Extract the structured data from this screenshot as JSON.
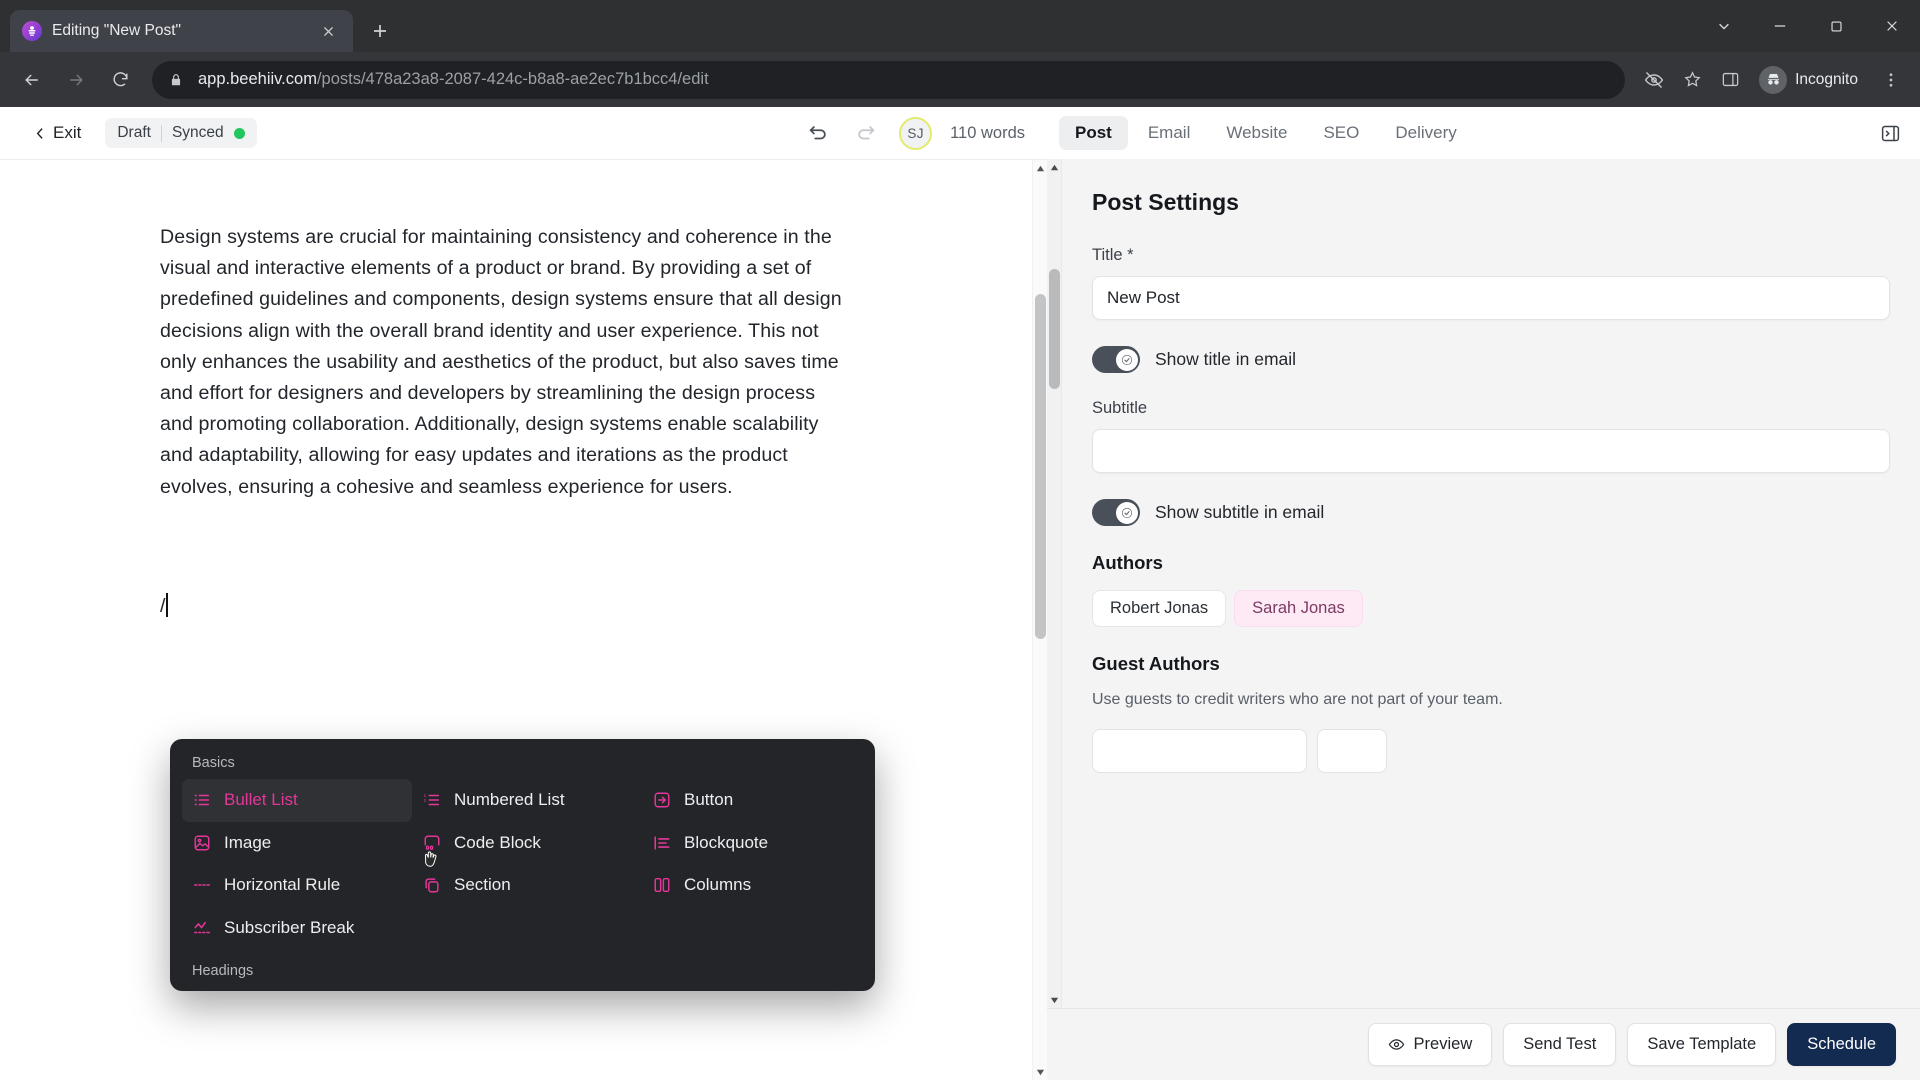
{
  "browser": {
    "tab": {
      "title": "Editing \"New Post\"",
      "favicon": "beehiiv-logo-icon",
      "close": "×"
    },
    "new_tab_label": "+",
    "window_controls": {
      "minimize": "—",
      "maximize": "▢",
      "close": "✕",
      "tab_search": "⌄"
    },
    "url": {
      "secure_icon": "lock-icon",
      "host": "app.beehiiv.com",
      "path": "/posts/478a23a8-2087-424c-b8a8-ae2ec7b1bcc4/edit"
    },
    "profile": {
      "label": "Incognito",
      "icon": "incognito-icon"
    },
    "toolbar_icons": [
      "third-party-cookie-blocked-icon",
      "bookmark-star-icon",
      "side-panel-icon",
      "chrome-menu-icon"
    ]
  },
  "editor": {
    "exit_label": "Exit",
    "status": {
      "state": "Draft",
      "sync": "Synced"
    },
    "word_count": "110 words",
    "avatar_initials": "SJ",
    "undo_label": "Undo",
    "redo_label": "Redo",
    "paragraph": "Design systems are crucial for maintaining consistency and coherence in the visual and interactive elements of a product or brand. By providing a set of predefined guidelines and components, design systems ensure that all design decisions align with the overall brand identity and user experience. This not only enhances the usability and aesthetics of the product, but also saves time and effort for designers and developers by streamlining the design process and promoting collaboration. Additionally, design systems enable scalability and adaptability, allowing for easy updates and iterations as the product evolves, ensuring a cohesive and seamless experience for users.",
    "slash_text": "/"
  },
  "slash_menu": {
    "sections": [
      {
        "label": "Basics",
        "items": [
          {
            "label": "Bullet List",
            "icon": "bullet-list-icon",
            "active": true
          },
          {
            "label": "Numbered List",
            "icon": "numbered-list-icon",
            "active": false
          },
          {
            "label": "Button",
            "icon": "button-icon",
            "active": false
          },
          {
            "label": "Image",
            "icon": "image-icon",
            "active": false
          },
          {
            "label": "Code Block",
            "icon": "code-block-icon",
            "active": false
          },
          {
            "label": "Blockquote",
            "icon": "blockquote-icon",
            "active": false
          },
          {
            "label": "Horizontal Rule",
            "icon": "horizontal-rule-icon",
            "active": false
          },
          {
            "label": "Section",
            "icon": "section-icon",
            "active": false
          },
          {
            "label": "Columns",
            "icon": "columns-icon",
            "active": false
          },
          {
            "label": "Subscriber Break",
            "icon": "subscriber-break-icon",
            "active": false
          }
        ]
      },
      {
        "label": "Headings",
        "items": []
      }
    ],
    "accent_color": "#e5369a"
  },
  "panel": {
    "tabs": [
      {
        "label": "Post",
        "active": true
      },
      {
        "label": "Email",
        "active": false
      },
      {
        "label": "Website",
        "active": false
      },
      {
        "label": "SEO",
        "active": false
      },
      {
        "label": "Delivery",
        "active": false
      }
    ],
    "expand_icon": "panel-collapse-icon",
    "heading": "Post Settings",
    "title_field": {
      "label": "Title *",
      "value": "New Post"
    },
    "show_title_toggle": {
      "label": "Show title in email",
      "on": true
    },
    "subtitle_field": {
      "label": "Subtitle",
      "value": "",
      "placeholder": ""
    },
    "show_subtitle_toggle": {
      "label": "Show subtitle in email",
      "on": true
    },
    "authors": {
      "heading": "Authors",
      "chips": [
        {
          "name": "Robert Jonas",
          "accent": false
        },
        {
          "name": "Sarah Jonas",
          "accent": true
        }
      ]
    },
    "guest_authors": {
      "heading": "Guest Authors",
      "description": "Use guests to credit writers who are not part of your team."
    },
    "actions": [
      {
        "label": "Preview",
        "icon": "eye-icon",
        "primary": false
      },
      {
        "label": "Send Test",
        "icon": "",
        "primary": false
      },
      {
        "label": "Save Template",
        "icon": "",
        "primary": false
      },
      {
        "label": "Schedule",
        "icon": "",
        "primary": true
      }
    ],
    "primary_color": "#132a51"
  }
}
